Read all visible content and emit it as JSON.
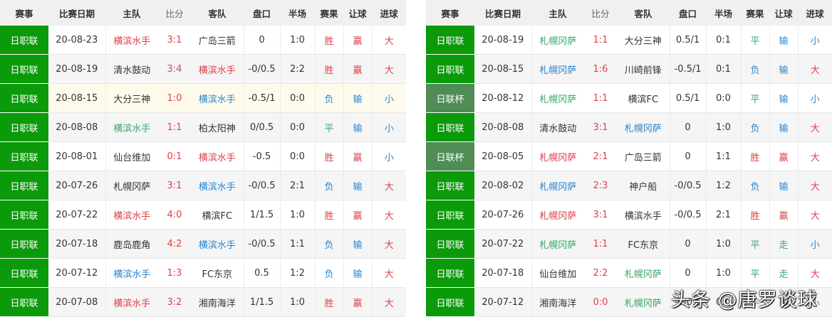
{
  "headers": [
    "赛事",
    "比赛日期",
    "主队",
    "比分",
    "客队",
    "盘口",
    "半场",
    "赛果",
    "让球",
    "进球"
  ],
  "colors": {
    "win": "#e0404a",
    "lose": "#2a86d0",
    "draw": "#3aa86a",
    "league": "#0a9a0a",
    "cup": "#4f8c56"
  },
  "left_table": {
    "rows": [
      {
        "league": "日职联",
        "date": "20-08-23",
        "home": "横滨水手",
        "hc": "r",
        "score": "3:1",
        "away": "广岛三箭",
        "ac": "k",
        "handicap": "0",
        "half": "1:0",
        "result": "胜",
        "rc": "r",
        "rang": "赢",
        "gc": "r",
        "goals": "大",
        "oc": "r"
      },
      {
        "league": "日职联",
        "date": "20-08-19",
        "home": "清水鼓动",
        "hc": "k",
        "score": "3:4",
        "away": "横滨水手",
        "ac": "r",
        "handicap": "-0/0.5",
        "half": "2:2",
        "result": "胜",
        "rc": "r",
        "rang": "赢",
        "gc": "r",
        "goals": "大",
        "oc": "r"
      },
      {
        "league": "日职联",
        "date": "20-08-15",
        "home": "大分三神",
        "hc": "k",
        "score": "1:0",
        "away": "横滨水手",
        "ac": "bl",
        "handicap": "-0.5/1",
        "half": "0:0",
        "result": "负",
        "rc": "bl",
        "rang": "输",
        "gc": "bl",
        "goals": "小",
        "oc": "bl",
        "highlight": true
      },
      {
        "league": "日职联",
        "date": "20-08-08",
        "home": "横滨水手",
        "hc": "g",
        "score": "1:1",
        "away": "柏太阳神",
        "ac": "k",
        "handicap": "0/0.5",
        "half": "0:0",
        "result": "平",
        "rc": "g",
        "rang": "输",
        "gc": "bl",
        "goals": "小",
        "oc": "bl"
      },
      {
        "league": "日职联",
        "date": "20-08-01",
        "home": "仙台维加",
        "hc": "k",
        "score": "0:1",
        "away": "横滨水手",
        "ac": "r",
        "handicap": "-0.5",
        "half": "0:0",
        "result": "胜",
        "rc": "r",
        "rang": "赢",
        "gc": "r",
        "goals": "小",
        "oc": "bl"
      },
      {
        "league": "日职联",
        "date": "20-07-26",
        "home": "札幌冈萨",
        "hc": "k",
        "score": "3:1",
        "away": "横滨水手",
        "ac": "bl",
        "handicap": "-0/0.5",
        "half": "2:1",
        "result": "负",
        "rc": "bl",
        "rang": "输",
        "gc": "bl",
        "goals": "大",
        "oc": "r"
      },
      {
        "league": "日职联",
        "date": "20-07-22",
        "home": "横滨水手",
        "hc": "r",
        "score": "4:0",
        "away": "横滨FC",
        "ac": "k",
        "handicap": "1/1.5",
        "half": "1:0",
        "result": "胜",
        "rc": "r",
        "rang": "赢",
        "gc": "r",
        "goals": "大",
        "oc": "r"
      },
      {
        "league": "日职联",
        "date": "20-07-18",
        "home": "鹿岛鹿角",
        "hc": "k",
        "score": "4:2",
        "away": "横滨水手",
        "ac": "bl",
        "handicap": "-0/0.5",
        "half": "1:1",
        "result": "负",
        "rc": "bl",
        "rang": "输",
        "gc": "bl",
        "goals": "大",
        "oc": "r"
      },
      {
        "league": "日职联",
        "date": "20-07-12",
        "home": "横滨水手",
        "hc": "bl",
        "score": "1:3",
        "away": "FC东京",
        "ac": "k",
        "handicap": "0.5",
        "half": "1:2",
        "result": "负",
        "rc": "bl",
        "rang": "输",
        "gc": "bl",
        "goals": "大",
        "oc": "r"
      },
      {
        "league": "日职联",
        "date": "20-07-08",
        "home": "横滨水手",
        "hc": "r",
        "score": "3:2",
        "away": "湘南海洋",
        "ac": "k",
        "handicap": "1/1.5",
        "half": "1:0",
        "result": "胜",
        "rc": "r",
        "rang": "赢",
        "gc": "r",
        "goals": "大",
        "oc": "r"
      }
    ]
  },
  "right_table": {
    "rows": [
      {
        "league": "日职联",
        "date": "20-08-19",
        "home": "札幌冈萨",
        "hc": "g",
        "score": "1:1",
        "away": "大分三神",
        "ac": "k",
        "handicap": "0.5/1",
        "half": "0:1",
        "result": "平",
        "rc": "g",
        "rang": "输",
        "gc": "bl",
        "goals": "小",
        "oc": "bl"
      },
      {
        "league": "日职联",
        "date": "20-08-15",
        "home": "札幌冈萨",
        "hc": "bl",
        "score": "1:6",
        "away": "川崎前锋",
        "ac": "k",
        "handicap": "-0.5/1",
        "half": "0:1",
        "result": "负",
        "rc": "bl",
        "rang": "输",
        "gc": "bl",
        "goals": "大",
        "oc": "r"
      },
      {
        "league": "日联杯",
        "cup": true,
        "date": "20-08-12",
        "home": "札幌冈萨",
        "hc": "g",
        "score": "1:1",
        "away": "横滨FC",
        "ac": "k",
        "handicap": "0.5/1",
        "half": "0:0",
        "result": "平",
        "rc": "g",
        "rang": "输",
        "gc": "bl",
        "goals": "小",
        "oc": "bl"
      },
      {
        "league": "日职联",
        "date": "20-08-08",
        "home": "清水鼓动",
        "hc": "k",
        "score": "3:1",
        "away": "札幌冈萨",
        "ac": "bl",
        "handicap": "0",
        "half": "1:0",
        "result": "负",
        "rc": "bl",
        "rang": "输",
        "gc": "bl",
        "goals": "大",
        "oc": "r"
      },
      {
        "league": "日联杯",
        "cup": true,
        "date": "20-08-05",
        "home": "札幌冈萨",
        "hc": "r",
        "score": "2:1",
        "away": "广岛三箭",
        "ac": "k",
        "handicap": "0",
        "half": "1:1",
        "result": "胜",
        "rc": "r",
        "rang": "赢",
        "gc": "r",
        "goals": "大",
        "oc": "r"
      },
      {
        "league": "日职联",
        "date": "20-08-02",
        "home": "札幌冈萨",
        "hc": "bl",
        "score": "2:3",
        "away": "神户船",
        "ac": "k",
        "handicap": "-0/0.5",
        "half": "1:2",
        "result": "负",
        "rc": "bl",
        "rang": "输",
        "gc": "bl",
        "goals": "大",
        "oc": "r"
      },
      {
        "league": "日职联",
        "date": "20-07-26",
        "home": "札幌冈萨",
        "hc": "r",
        "score": "3:1",
        "away": "横滨水手",
        "ac": "k",
        "handicap": "-0/0.5",
        "half": "2:1",
        "result": "胜",
        "rc": "r",
        "rang": "赢",
        "gc": "r",
        "goals": "大",
        "oc": "r"
      },
      {
        "league": "日职联",
        "date": "20-07-22",
        "home": "札幌冈萨",
        "hc": "g",
        "score": "1:1",
        "away": "FC东京",
        "ac": "k",
        "handicap": "0",
        "half": "1:0",
        "result": "平",
        "rc": "g",
        "rang": "走",
        "gc": "g",
        "goals": "小",
        "oc": "bl"
      },
      {
        "league": "日职联",
        "date": "20-07-18",
        "home": "仙台维加",
        "hc": "k",
        "score": "2:2",
        "away": "札幌冈萨",
        "ac": "g",
        "handicap": "0",
        "half": "1:0",
        "result": "平",
        "rc": "g",
        "rang": "走",
        "gc": "g",
        "goals": "大",
        "oc": "r"
      },
      {
        "league": "日职联",
        "date": "20-07-12",
        "home": "湘南海洋",
        "hc": "k",
        "score": "0:0",
        "away": "札幌冈萨",
        "ac": "g",
        "handicap": "-0/0.5",
        "half": "0:0",
        "result": "平",
        "rc": "g",
        "rang": "输",
        "gc": "bl",
        "goals": "小",
        "oc": "bl"
      }
    ]
  },
  "watermark": "头条 @唐罗谈球"
}
